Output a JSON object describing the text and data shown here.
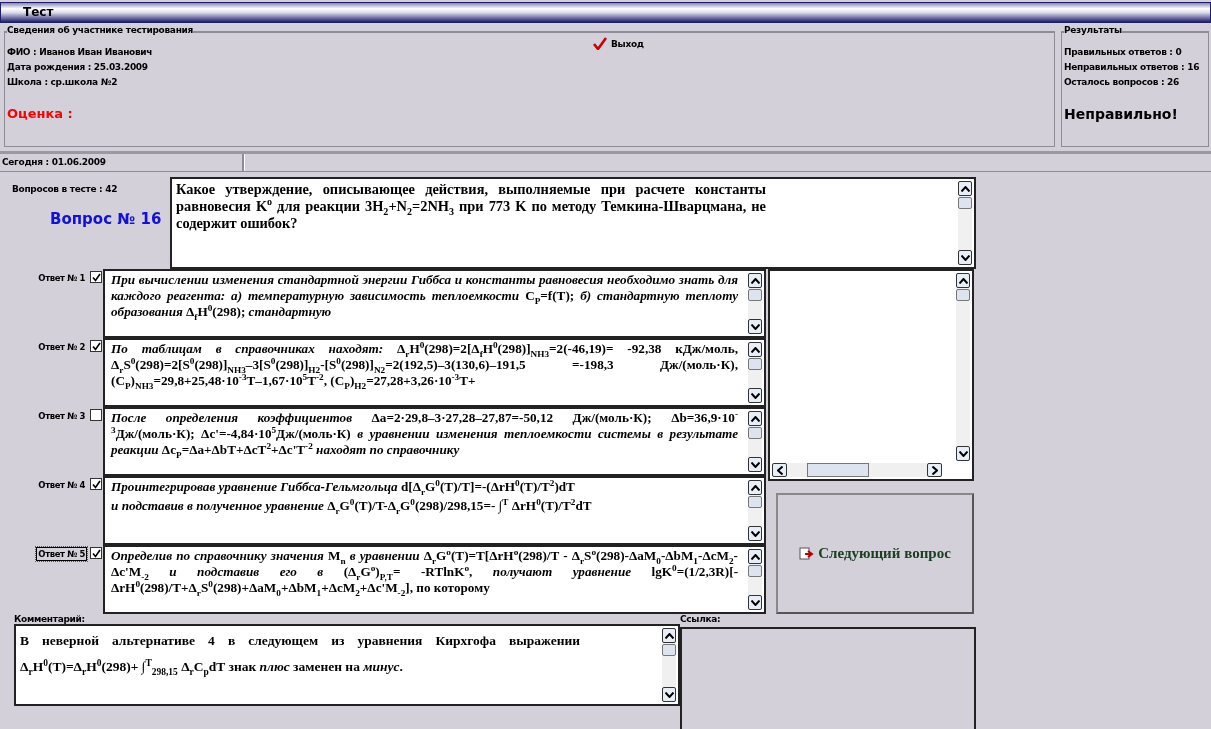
{
  "window": {
    "title": "Тест"
  },
  "participant": {
    "group_label": "Сведения об участнике тестирования",
    "fields": [
      "ФИО : Иванов Иван Иванович",
      "Дата рождения : 25.03.2009",
      "Школа : ср.школа №2"
    ],
    "grade_label": "Оценка :"
  },
  "exit_button": {
    "label": "Выход"
  },
  "results": {
    "group_label": "Результаты",
    "lines": [
      "Правильных ответов : 0",
      "Неправильных ответов : 16",
      "Осталось вопросов : 26"
    ],
    "verdict": "Неправильно!"
  },
  "status_bar": {
    "date": "Сегодня : 01.06.2009"
  },
  "question": {
    "count": "Вопросов в тесте : 42",
    "number": "Вопрос № 16",
    "text": "Какое утверждение, описывающее действия, выполняемые при расчете константы равновесия K$^{o}$ для реакции 3H$_{2}$+N$_{2}$=2NH$_{3}$ при 773 K по методу Темкина-Шварцмана, не содержит ошибок?"
  },
  "answers": [
    {
      "label": "Ответ № 1",
      "checked": true,
      "focused": false,
      "lines": [
        "*При вычислении изменения стандартной энергии Гиббса и константы равновесия необходимо знать для каждого реагента: а) температурную зависимость теплоемкости* C$_{P}$=f(T); *б) стандартную теплоту образования* Δ$_{f}$H$^{0}$(298); *стандартную*"
      ]
    },
    {
      "label": "Ответ № 2",
      "checked": true,
      "focused": false,
      "lines": [
        "*По таблицам в справочниках находят:* Δ$_{r}$H$^{0}$(298)=2[Δ$_{f}$H$^{0}$(298)]$_{NH3}$=2(-46,19)= -92,38 кДж/моль, Δ$_{r}$S$^{0}$(298)=2[S$^{0}$(298)]$_{NH3}$–3[S$^{0}$(298)]$_{H2}$-[S$^{0}$(298)]$_{N2}$=2(192,5)–3(130,6)–191,5 =-198,3 Дж/(моль·К), (C$_{P}$)$_{NH3}$=29,8+25,48·10$^{-3}$T–1,67·10$^{5}$T$^{-2}$, (C$_{P}$)$_{H2}$=27,28+3,26·10$^{-3}$T+"
      ]
    },
    {
      "label": "Ответ № 3",
      "checked": false,
      "focused": false,
      "lines": [
        "*После определения коэффициентов* Δa=2·29,8–3·27,28–27,87=-50,12 Дж/(моль·К); Δb=36,9·10$^{-3}$Дж/(моль·К); Δc'=-4,84·10$^{5}$Дж/(моль·К) *в уравнении изменения теплоемкости системы в результате реакции* Δc$_{P}$=Δa+ΔbT+ΔcT$^{2}$+Δc'T$^{-2}$ *находят по справочнику*"
      ]
    },
    {
      "label": "Ответ № 4",
      "checked": true,
      "focused": false,
      "lines": [
        "*Проинтегрировав уравнение Гиббса-Гельмгольца* d[Δ$_{r}$G$^{0}$(T)/T]=-(ΔrH$^{0}$(T)/T$^{2}$)dT",
        "*и подставив в полученное уравнение* Δ$_{r}$G$^{0}$(T)/T-Δ$_{r}$G$^{0}$(298)/298,15=- ∫$^{T}$ ΔrH$^{0}$(T)/T$^{2}$dT"
      ]
    },
    {
      "label": "Ответ № 5",
      "checked": true,
      "focused": true,
      "lines": [
        "*Определив по справочнику значения* M$_{n}$ *в уравнении* Δ$_{r}$G$^{o}$(T)=T[ΔrH$^{o}$(298)/T - Δ$_{r}$S$^{o}$(298)-ΔaM$_{0}$-ΔbM$_{1}$-ΔcM$_{2}$-Δc'M$_{-2}$ *и подставив его в* (Δ$_{r}$G$^{o}$)$_{P,T}$= -RTlnK$^{o}$, *получают уравнение* lgK$^{0}$=(1/2,3R)[-ΔrH$^{0}$(298)/T+Δ$_{r}$S$^{0}$(298)+ΔaM$_{0}$+ΔbM$_{1}$+ΔcM$_{2}$+Δc'M$_{-2}$], по которому"
      ]
    }
  ],
  "next_button": {
    "label": "Следующий вопрос"
  },
  "comment": {
    "label": "Комментарий:",
    "text": "В неверной альтернативе 4 в следующем из уравнения Кирхгофа выражении Δ$_{r}$H$^{0}$(T)=Δ$_{r}$H$^{0}$(298)+ ∫$^{T}$$_{298,15}$ Δ$_{r}$C$_{p}$dT знак *плюс* заменен на *минус*."
  },
  "link": {
    "label": "Ссылка:"
  }
}
